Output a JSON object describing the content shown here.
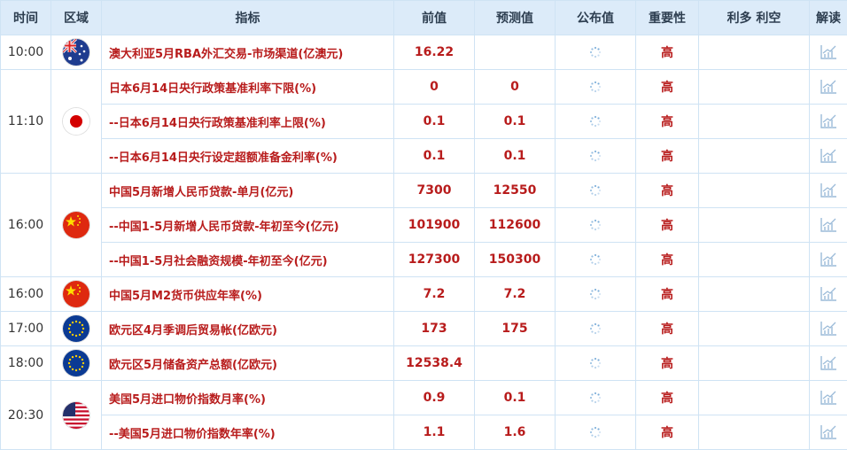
{
  "header": {
    "time": "时间",
    "region": "区域",
    "indicator": "指标",
    "previous": "前值",
    "forecast": "预测值",
    "actual": "公布值",
    "importance": "重要性",
    "effect": "利多 利空",
    "interpretation": "解读"
  },
  "groups": [
    {
      "time": "10:00",
      "flag": "australia-flag-icon",
      "rows": [
        {
          "indicator": "澳大利亚5月RBA外汇交易-市场渠道(亿澳元)",
          "previous": "16.22",
          "forecast": "",
          "importance": "高"
        }
      ]
    },
    {
      "time": "11:10",
      "flag": "japan-flag-icon",
      "rows": [
        {
          "indicator": "日本6月14日央行政策基准利率下限(%)",
          "previous": "0",
          "forecast": "0",
          "importance": "高"
        },
        {
          "indicator": "--日本6月14日央行政策基准利率上限(%)",
          "previous": "0.1",
          "forecast": "0.1",
          "importance": "高"
        },
        {
          "indicator": "--日本6月14日央行设定超额准备金利率(%)",
          "previous": "0.1",
          "forecast": "0.1",
          "importance": "高"
        }
      ]
    },
    {
      "time": "16:00",
      "flag": "china-flag-icon",
      "rows": [
        {
          "indicator": "中国5月新增人民币贷款-单月(亿元)",
          "previous": "7300",
          "forecast": "12550",
          "importance": "高"
        },
        {
          "indicator": "--中国1-5月新增人民币贷款-年初至今(亿元)",
          "previous": "101900",
          "forecast": "112600",
          "importance": "高"
        },
        {
          "indicator": "--中国1-5月社会融资规模-年初至今(亿元)",
          "previous": "127300",
          "forecast": "150300",
          "importance": "高"
        }
      ]
    },
    {
      "time": "16:00",
      "flag": "china-flag-icon",
      "rows": [
        {
          "indicator": "中国5月M2货币供应年率(%)",
          "previous": "7.2",
          "forecast": "7.2",
          "importance": "高"
        }
      ]
    },
    {
      "time": "17:00",
      "flag": "eu-flag-icon",
      "rows": [
        {
          "indicator": "欧元区4月季调后贸易帐(亿欧元)",
          "previous": "173",
          "forecast": "175",
          "importance": "高"
        }
      ]
    },
    {
      "time": "18:00",
      "flag": "eu-flag-icon",
      "rows": [
        {
          "indicator": "欧元区5月储备资产总额(亿欧元)",
          "previous": "12538.4",
          "forecast": "",
          "importance": "高"
        }
      ]
    },
    {
      "time": "20:30",
      "flag": "usa-flag-icon",
      "rows": [
        {
          "indicator": "美国5月进口物价指数月率(%)",
          "previous": "0.9",
          "forecast": "0.1",
          "importance": "高"
        },
        {
          "indicator": "--美国5月进口物价指数年率(%)",
          "previous": "1.1",
          "forecast": "1.6",
          "importance": "高"
        }
      ]
    }
  ]
}
